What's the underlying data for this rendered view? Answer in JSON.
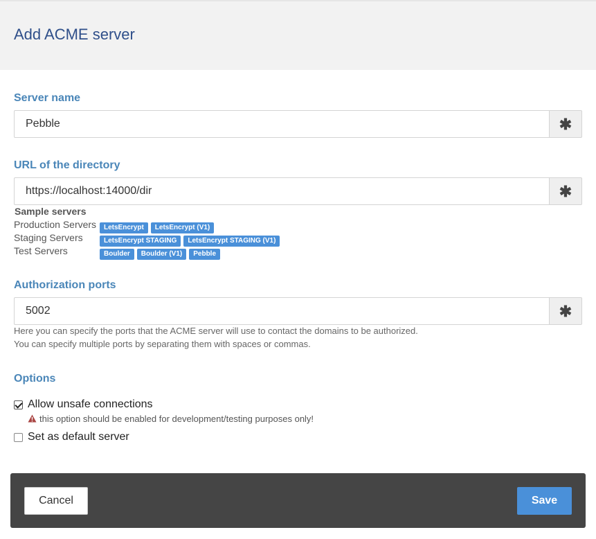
{
  "header": {
    "title": "Add ACME server"
  },
  "server_name": {
    "label": "Server name",
    "value": "Pebble",
    "required_symbol": "✱"
  },
  "directory_url": {
    "label": "URL of the directory",
    "value": "https://localhost:14000/dir",
    "required_symbol": "✱"
  },
  "samples": {
    "title": "Sample servers",
    "rows": [
      {
        "label": "Production Servers",
        "badges": [
          "LetsEncrypt",
          "LetsEncrypt (V1)"
        ]
      },
      {
        "label": "Staging Servers",
        "badges": [
          "LetsEncrypt STAGING",
          "LetsEncrypt STAGING (V1)"
        ]
      },
      {
        "label": "Test Servers",
        "badges": [
          "Boulder",
          "Boulder (V1)",
          "Pebble"
        ]
      }
    ]
  },
  "auth_ports": {
    "label": "Authorization ports",
    "value": "5002",
    "required_symbol": "✱",
    "help_line1": "Here you can specify the ports that the ACME server will use to contact the domains to be authorized.",
    "help_line2": "You can specify multiple ports by separating them with spaces or commas."
  },
  "options": {
    "label": "Options",
    "allow_unsafe": {
      "label": "Allow unsafe connections",
      "checked": true
    },
    "warning": "this option should be enabled for development/testing purposes only!",
    "set_default": {
      "label": "Set as default server",
      "checked": false
    }
  },
  "footer": {
    "cancel_label": "Cancel",
    "save_label": "Save"
  },
  "colors": {
    "accent": "#4a90d9",
    "label": "#4a86b8",
    "footer_bg": "#454545",
    "header_bg": "#f2f2f2",
    "warning": "#a94442"
  },
  "icons": {
    "required": "asterisk-icon",
    "warning": "warning-triangle-icon",
    "checkbox": "checkbox-icon"
  }
}
